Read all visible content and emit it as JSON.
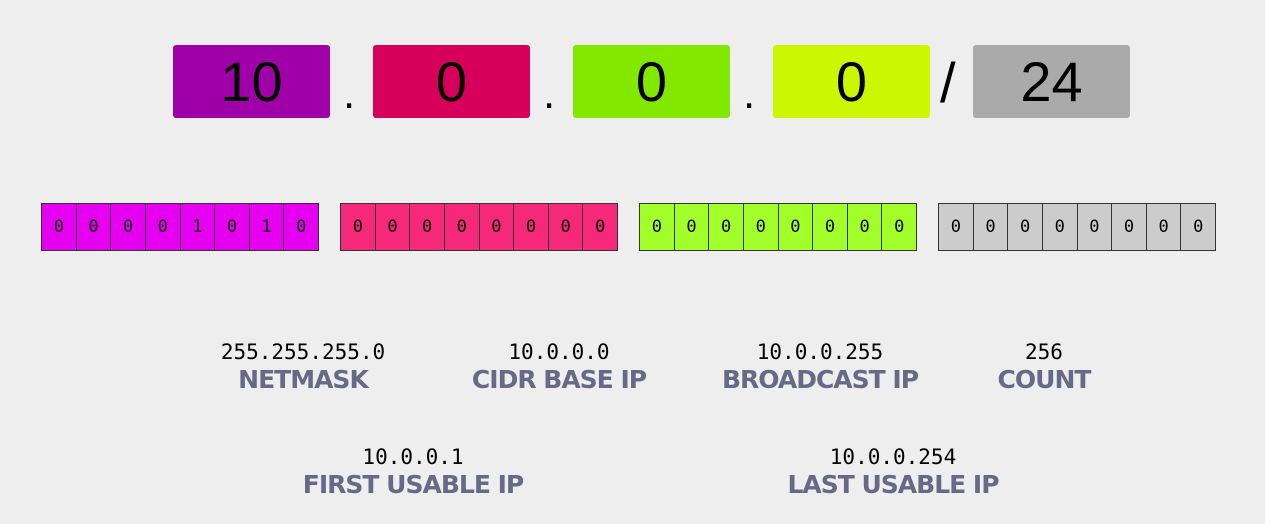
{
  "octets": [
    {
      "value": "10",
      "color": "#a000a8"
    },
    {
      "value": "0",
      "color": "#d6005a"
    },
    {
      "value": "0",
      "color": "#82e800"
    },
    {
      "value": "0",
      "color": "#cdf700"
    }
  ],
  "separators": {
    "dot": ".",
    "slash": "/"
  },
  "prefix": {
    "value": "24",
    "color": "#aaaaaa"
  },
  "bit_groups": [
    {
      "bits": [
        "0",
        "0",
        "0",
        "0",
        "1",
        "0",
        "1",
        "0"
      ],
      "color": "#e600f0"
    },
    {
      "bits": [
        "0",
        "0",
        "0",
        "0",
        "0",
        "0",
        "0",
        "0"
      ],
      "color": "#f5287a"
    },
    {
      "bits": [
        "0",
        "0",
        "0",
        "0",
        "0",
        "0",
        "0",
        "0"
      ],
      "color": "#a2ff2a"
    },
    {
      "bits": [
        "0",
        "0",
        "0",
        "0",
        "0",
        "0",
        "0",
        "0"
      ],
      "color": "#cccccc"
    }
  ],
  "stats": {
    "netmask": {
      "value": "255.255.255.0",
      "label": "NETMASK"
    },
    "cidr_base_ip": {
      "value": "10.0.0.0",
      "label": "CIDR BASE IP"
    },
    "broadcast_ip": {
      "value": "10.0.0.255",
      "label": "BROADCAST IP"
    },
    "count": {
      "value": "256",
      "label": "COUNT"
    },
    "first_usable_ip": {
      "value": "10.0.0.1",
      "label": "FIRST USABLE IP"
    },
    "last_usable_ip": {
      "value": "10.0.0.254",
      "label": "LAST USABLE IP"
    }
  }
}
